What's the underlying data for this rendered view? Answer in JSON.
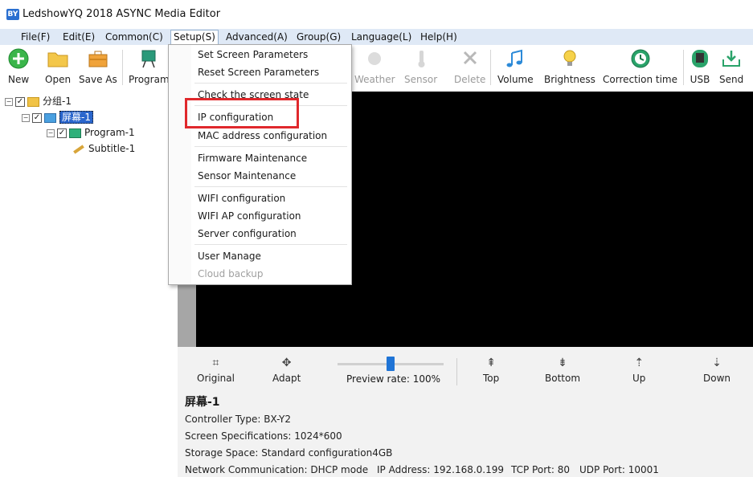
{
  "window": {
    "title": "LedshowYQ 2018 ASYNC Media Editor",
    "app_icon_text": "BY"
  },
  "menubar": [
    {
      "label": "File(F)"
    },
    {
      "label": "Edit(E)"
    },
    {
      "label": "Common(C)"
    },
    {
      "label": "Setup(S)"
    },
    {
      "label": "Advanced(A)"
    },
    {
      "label": "Group(G)"
    },
    {
      "label": "Language(L)"
    },
    {
      "label": "Help(H)"
    }
  ],
  "toolbar": {
    "new": "New",
    "open": "Open",
    "save_as": "Save As",
    "program": "Program",
    "weather": "Weather",
    "sensor": "Sensor",
    "delete": "Delete",
    "volume": "Volume",
    "brightness": "Brightness",
    "correction_time": "Correction time",
    "usb": "USB",
    "send": "Send"
  },
  "setup_menu": {
    "items": [
      {
        "label": "Set Screen Parameters"
      },
      {
        "label": "Reset Screen Parameters"
      },
      {
        "label": "Check the screen state"
      },
      {
        "label": "IP configuration"
      },
      {
        "label": "MAC address configuration"
      },
      {
        "label": "Firmware Maintenance"
      },
      {
        "label": "Sensor Maintenance"
      },
      {
        "label": "WIFI configuration"
      },
      {
        "label": "WIFI AP configuration"
      },
      {
        "label": "Server configuration"
      },
      {
        "label": "User Manage"
      },
      {
        "label": "Cloud backup"
      }
    ]
  },
  "tree": {
    "group": "分组-1",
    "screen": "屏幕-1",
    "program": "Program-1",
    "subtitle": "Subtitle-1"
  },
  "preview_controls": {
    "original": "Original",
    "adapt": "Adapt",
    "preview_rate": "Preview rate: 100%",
    "top": "Top",
    "bottom": "Bottom",
    "up": "Up",
    "down": "Down",
    "preview_rate_value": 1.0
  },
  "screen_info": {
    "name": "屏幕-1",
    "controller_type": "Controller Type: BX-Y2",
    "screen_spec": "Screen Specifications: 1024*600",
    "storage": "Storage Space: Standard configuration4GB",
    "network": "Network Communication: DHCP mode",
    "ip": "IP Address: 192.168.0.199",
    "tcp": "TCP Port: 80",
    "udp": "UDP Port: 10001"
  }
}
